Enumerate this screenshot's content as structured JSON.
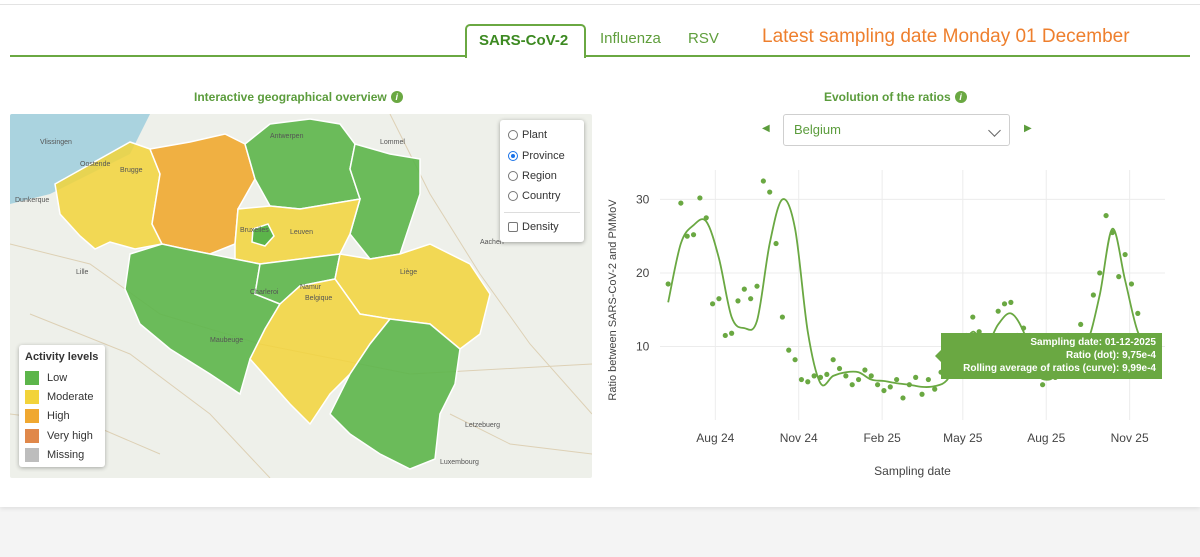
{
  "tabs": [
    {
      "label": "SARS-CoV-2",
      "active": true
    },
    {
      "label": "Influenza",
      "active": false
    },
    {
      "label": "RSV",
      "active": false
    }
  ],
  "latest_sampling": "Latest sampling date Monday 01 December",
  "map_section": {
    "title": "Interactive geographical overview",
    "layer_options": [
      {
        "label": "Plant",
        "selected": false
      },
      {
        "label": "Province",
        "selected": true
      },
      {
        "label": "Region",
        "selected": false
      },
      {
        "label": "Country",
        "selected": false
      }
    ],
    "density_label": "Density",
    "density_checked": false,
    "legend": {
      "title": "Activity levels",
      "items": [
        {
          "label": "Low",
          "color": "#5cb54a"
        },
        {
          "label": "Moderate",
          "color": "#f2d33a"
        },
        {
          "label": "High",
          "color": "#f0a830"
        },
        {
          "label": "Very high",
          "color": "#e0884a"
        },
        {
          "label": "Missing",
          "color": "#bdbdbd"
        }
      ]
    },
    "map_labels": [
      "Vlissingen",
      "Oostende",
      "Brugge",
      "Dunkerque",
      "Lille",
      "Antwerpen",
      "Bruxelles",
      "Leuven",
      "Liège",
      "Namur",
      "Belgique",
      "Maubeuge",
      "Charleroi",
      "Luxembourg",
      "Letzebuerg",
      "Aachen",
      "Lommel"
    ]
  },
  "chart_section": {
    "title": "Evolution of the ratios",
    "selected_region": "Belgium",
    "tooltip": {
      "date_label": "Sampling date",
      "date_value": "01-12-2025",
      "ratio_label": "Ratio (dot)",
      "ratio_value": "9,75e-4",
      "rolling_label": "Rolling average of ratios (curve)",
      "rolling_value": "9,99e-4"
    }
  },
  "chart_data": {
    "type": "scatter",
    "xlabel": "Sampling date",
    "ylabel": "Ratio between SARS-CoV-2 and PMMoV",
    "x_ticks": [
      "Aug 24",
      "Nov 24",
      "Feb 25",
      "May 25",
      "Aug 25",
      "Nov 25"
    ],
    "y_ticks": [
      10,
      20,
      30
    ],
    "ylim": [
      0,
      34
    ],
    "series": [
      {
        "type": "scatter",
        "x": [
          "2024-06-10",
          "2024-06-24",
          "2024-07-01",
          "2024-07-08",
          "2024-07-15",
          "2024-07-22",
          "2024-07-29",
          "2024-08-05",
          "2024-08-12",
          "2024-08-19",
          "2024-08-26",
          "2024-09-02",
          "2024-09-09",
          "2024-09-16",
          "2024-09-23",
          "2024-09-30",
          "2024-10-07",
          "2024-10-14",
          "2024-10-21",
          "2024-10-28",
          "2024-11-04",
          "2024-11-11",
          "2024-11-18",
          "2024-11-25",
          "2024-12-02",
          "2024-12-09",
          "2024-12-16",
          "2024-12-23",
          "2024-12-30",
          "2025-01-06",
          "2025-01-13",
          "2025-01-20",
          "2025-01-27",
          "2025-02-03",
          "2025-02-10",
          "2025-02-17",
          "2025-02-24",
          "2025-03-03",
          "2025-03-10",
          "2025-03-17",
          "2025-03-24",
          "2025-03-31",
          "2025-04-07",
          "2025-04-14",
          "2025-04-21",
          "2025-04-28",
          "2025-05-05",
          "2025-05-12",
          "2025-05-19",
          "2025-05-26",
          "2025-06-02",
          "2025-06-09",
          "2025-06-16",
          "2025-06-23",
          "2025-06-30",
          "2025-07-07",
          "2025-07-14",
          "2025-07-21",
          "2025-07-28",
          "2025-08-04",
          "2025-08-11",
          "2025-08-18",
          "2025-08-25",
          "2025-09-01",
          "2025-09-08",
          "2025-09-15",
          "2025-09-22",
          "2025-09-29",
          "2025-10-06",
          "2025-10-13",
          "2025-10-20",
          "2025-10-27",
          "2025-11-03",
          "2025-11-10",
          "2025-11-17",
          "2025-11-24",
          "2025-12-01"
        ],
        "y": [
          18.5,
          29.5,
          25,
          25.2,
          30.2,
          27.5,
          15.8,
          16.5,
          11.5,
          11.8,
          16.2,
          17.8,
          16.5,
          18.2,
          32.5,
          31,
          24,
          14,
          9.5,
          8.2,
          5.5,
          5.2,
          6,
          5.8,
          6.2,
          8.2,
          7,
          6,
          4.8,
          5.5,
          6.8,
          6,
          4.8,
          4,
          4.5,
          5.5,
          3,
          4.8,
          5.8,
          3.5,
          5.5,
          4.2,
          6.5,
          9.5,
          10.5,
          8.5,
          11.5,
          14,
          12,
          11.2,
          9.8,
          14.8,
          15.8,
          16,
          11.5,
          12.5,
          11.5,
          7.5,
          4.8,
          6.5,
          5.8,
          8.5,
          11.5,
          9,
          13,
          10,
          17,
          20,
          27.8,
          25.5,
          19.5,
          22.5,
          18.5,
          14.5,
          10.5,
          10,
          9.75
        ]
      },
      {
        "type": "line",
        "x": [
          "2024-06-10",
          "2024-06-24",
          "2024-07-08",
          "2024-07-22",
          "2024-08-05",
          "2024-08-19",
          "2024-09-02",
          "2024-09-16",
          "2024-09-30",
          "2024-10-14",
          "2024-10-28",
          "2024-11-11",
          "2024-11-25",
          "2024-12-09",
          "2024-12-23",
          "2025-01-06",
          "2025-01-20",
          "2025-02-03",
          "2025-02-17",
          "2025-03-03",
          "2025-03-17",
          "2025-03-31",
          "2025-04-14",
          "2025-04-28",
          "2025-05-12",
          "2025-05-26",
          "2025-06-09",
          "2025-06-23",
          "2025-07-07",
          "2025-07-21",
          "2025-08-04",
          "2025-08-18",
          "2025-09-01",
          "2025-09-15",
          "2025-09-29",
          "2025-10-13",
          "2025-10-27",
          "2025-11-10",
          "2025-11-24",
          "2025-12-01"
        ],
        "y": [
          16,
          24,
          26.5,
          27,
          22,
          14,
          12.5,
          13.5,
          24,
          30,
          26,
          12,
          5,
          6,
          6.5,
          6.5,
          5.5,
          5.3,
          5,
          4.8,
          4.5,
          4.6,
          5.5,
          9,
          12,
          10,
          13,
          14.5,
          12,
          6.5,
          5.5,
          7,
          9.8,
          10.5,
          17,
          26,
          19,
          12,
          10,
          9.99
        ]
      }
    ]
  }
}
